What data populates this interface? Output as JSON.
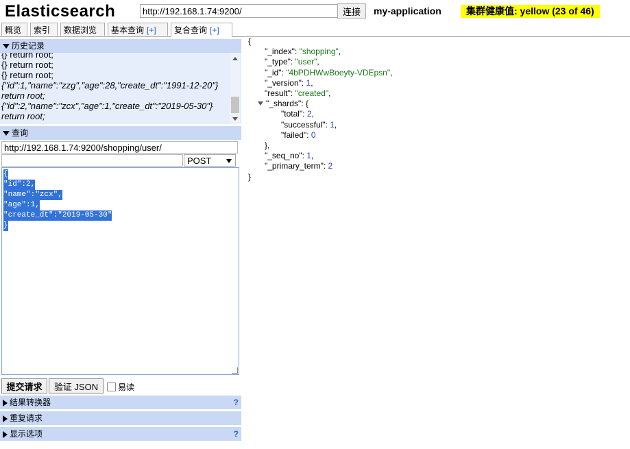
{
  "app": {
    "title": "Elasticsearch",
    "url": "http://192.168.1.74:9200/",
    "connect_label": "连接",
    "cluster_name": "my-application",
    "health_text": "集群健康值: yellow (23 of 46)"
  },
  "tabs": [
    {
      "label": "概览",
      "plus": ""
    },
    {
      "label": "索引",
      "plus": ""
    },
    {
      "label": "数据浏览",
      "plus": ""
    },
    {
      "label": "基本查询",
      "plus": "[+]"
    },
    {
      "label": "复合查询",
      "plus": "[+]"
    }
  ],
  "history": {
    "title": "历史记录",
    "lines": [
      "{} return root;",
      "{} return root;",
      "{} return root;",
      "{\"id\":1,\"name\":\"zzg\",\"age\":28,\"create_dt\":\"1991-12-20\"} return root;",
      "{\"id\":2,\"name\":\"zcx\",\"age\":1,\"create_dt\":\"2019-05-30\"} return root;"
    ]
  },
  "query": {
    "title": "查询",
    "url": "http://192.168.1.74:9200/shopping/user/",
    "path": "",
    "method": "POST",
    "body_lines": [
      "{",
      "\"id\":2,",
      "\"name\":\"zcx\",",
      "\"age\":1,",
      "\"create_dt\":\"2019-05-30\"",
      "}"
    ],
    "submit_label": "提交请求",
    "validate_label": "验证 JSON",
    "easy_read_label": "易读"
  },
  "collapsibles": [
    {
      "label": "结果转换器",
      "help": "?"
    },
    {
      "label": "重复请求",
      "help": ""
    },
    {
      "label": "显示选项",
      "help": "?"
    }
  ],
  "response": {
    "lines": [
      {
        "indent": 0,
        "key": "",
        "value": "{",
        "vtype": "punct"
      },
      {
        "indent": 1,
        "key": "\"_index\": ",
        "value": "\"shopping\"",
        "vtype": "str",
        "suffix": ","
      },
      {
        "indent": 1,
        "key": "\"_type\": ",
        "value": "\"user\"",
        "vtype": "str",
        "suffix": ","
      },
      {
        "indent": 1,
        "key": "\"_id\": ",
        "value": "\"4bPDHWwBoeyty-VDEpsn\"",
        "vtype": "str",
        "suffix": ","
      },
      {
        "indent": 1,
        "key": "\"_version\": ",
        "value": "1",
        "vtype": "num",
        "suffix": ","
      },
      {
        "indent": 1,
        "key": "\"result\": ",
        "value": "\"created\"",
        "vtype": "str",
        "suffix": ","
      },
      {
        "indent": 1,
        "key": "\"_shards\": ",
        "value": "{",
        "vtype": "punct",
        "toggle": true
      },
      {
        "indent": 2,
        "key": "\"total\": ",
        "value": "2",
        "vtype": "num",
        "suffix": ","
      },
      {
        "indent": 2,
        "key": "\"successful\": ",
        "value": "1",
        "vtype": "num",
        "suffix": ","
      },
      {
        "indent": 2,
        "key": "\"failed\": ",
        "value": "0",
        "vtype": "num"
      },
      {
        "indent": 1,
        "key": "",
        "value": "},",
        "vtype": "punct"
      },
      {
        "indent": 1,
        "key": "\"_seq_no\": ",
        "value": "1",
        "vtype": "num",
        "suffix": ","
      },
      {
        "indent": 1,
        "key": "\"_primary_term\": ",
        "value": "2",
        "vtype": "num"
      },
      {
        "indent": 0,
        "key": "",
        "value": "}",
        "vtype": "punct"
      }
    ]
  }
}
